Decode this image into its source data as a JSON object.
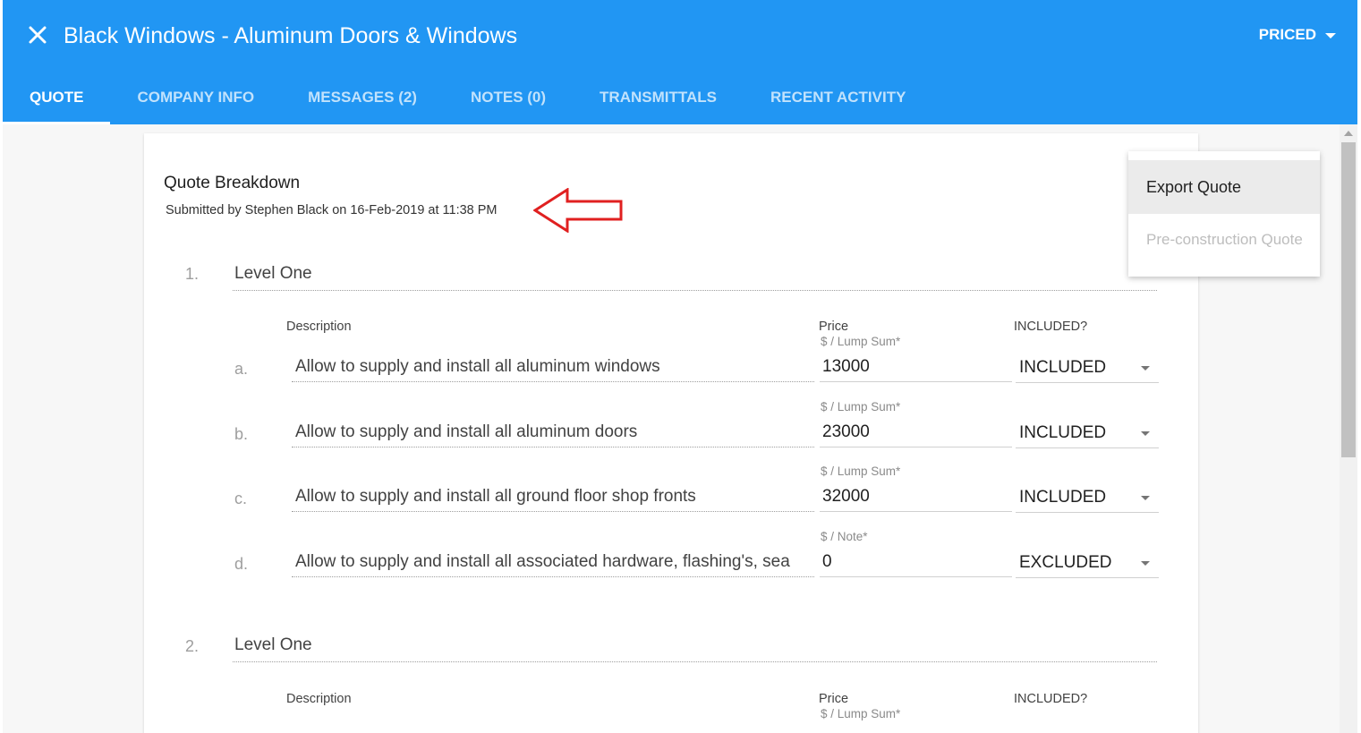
{
  "header": {
    "title": "Black Windows - Aluminum Doors & Windows",
    "status": "PRICED",
    "tabs": [
      "QUOTE",
      "COMPANY INFO",
      "MESSAGES (2)",
      "NOTES (0)",
      "TRANSMITTALS",
      "RECENT ACTIVITY"
    ],
    "active_tab": "QUOTE"
  },
  "quote": {
    "title": "Quote Breakdown",
    "submitted": "Submitted by Stephen Black on 16-Feb-2019 at 11:38 PM",
    "columns": {
      "description": "Description",
      "price": "Price",
      "included": "INCLUDED?"
    },
    "sections": [
      {
        "number": "1.",
        "name": "Level One",
        "items": [
          {
            "letter": "a.",
            "unit": "$ / Lump Sum",
            "description": "Allow to supply and install all aluminum windows",
            "price": "13000",
            "status": "INCLUDED"
          },
          {
            "letter": "b.",
            "unit": "$ / Lump Sum",
            "description": "Allow to supply and install all aluminum doors",
            "price": "23000",
            "status": "INCLUDED"
          },
          {
            "letter": "c.",
            "unit": "$ / Lump Sum",
            "description": "Allow to supply and install all ground floor shop fronts",
            "price": "32000",
            "status": "INCLUDED"
          },
          {
            "letter": "d.",
            "unit": "$ / Note",
            "description": "Allow to supply and install all associated hardware, flashing's, sea",
            "price": "0",
            "status": "EXCLUDED"
          }
        ]
      },
      {
        "number": "2.",
        "name": "Level One",
        "items": [
          {
            "unit": "$ / Lump Sum"
          }
        ]
      }
    ]
  },
  "menu": {
    "items": [
      "Export Quote",
      "Pre-construction Quote"
    ]
  },
  "icons": [
    "close-icon",
    "dropdown-caret-icon",
    "red-arrow-annotation"
  ],
  "colors": {
    "header": "#2196f3",
    "annotation": "#e02020"
  }
}
